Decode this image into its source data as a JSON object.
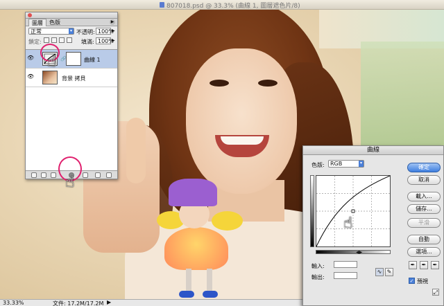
{
  "window": {
    "title": "807018.psd @ 33.3% (曲線 1, 圖層遮色片/8)"
  },
  "status_bar": {
    "zoom": "33.33%",
    "doc_size": "文件: 17.2M/17.2M",
    "arrow": "▶"
  },
  "layers_panel": {
    "tabs": [
      "圖層",
      "色版"
    ],
    "blend_mode": "正常",
    "opacity_label": "不透明:",
    "opacity_value": "100%",
    "lock_label": "鎖定:",
    "fill_label": "填滿:",
    "fill_value": "100%",
    "layers": [
      {
        "name": "曲線 1",
        "selected": true
      },
      {
        "name": "背景 拷貝",
        "selected": false
      }
    ]
  },
  "curves_dialog": {
    "title": "曲線",
    "channel_label": "色版:",
    "channel_value": "RGB",
    "buttons": {
      "ok": "確定",
      "cancel": "取消",
      "load": "載入...",
      "save": "儲存...",
      "smooth": "平滑",
      "auto": "自動",
      "options": "選項..."
    },
    "input_label": "輸入:",
    "output_label": "輸出:",
    "preview_label": "預視",
    "preview_checked": true,
    "curve_points": [
      [
        0,
        0
      ],
      [
        255,
        255
      ]
    ]
  },
  "colors": {
    "highlight_ring": "#e0206e",
    "default_button": "#3f7fe0",
    "selected_layer": "#b9cbe8"
  }
}
